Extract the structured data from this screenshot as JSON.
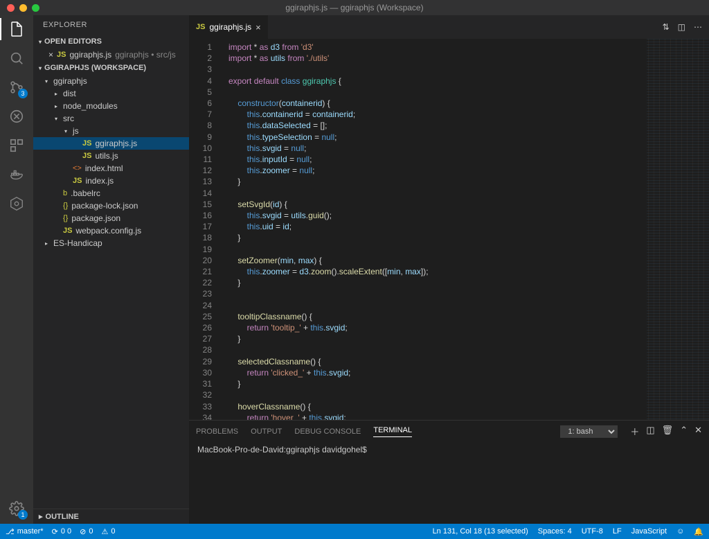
{
  "title": "ggiraphjs.js — ggiraphjs (Workspace)",
  "sidebar": {
    "header": "EXPLORER",
    "openEditors": {
      "label": "OPEN EDITORS",
      "items": [
        {
          "label": "ggiraphjs.js",
          "detail": "ggiraphjs • src/js"
        }
      ]
    },
    "workspace": {
      "label": "GGIRAPHJS (WORKSPACE)"
    },
    "tree": [
      {
        "indent": 0,
        "chev": "▾",
        "name": "ggiraphjs",
        "type": "folder"
      },
      {
        "indent": 1,
        "chev": "▸",
        "name": "dist",
        "type": "folder"
      },
      {
        "indent": 1,
        "chev": "▸",
        "name": "node_modules",
        "type": "folder"
      },
      {
        "indent": 1,
        "chev": "▾",
        "name": "src",
        "type": "folder"
      },
      {
        "indent": 2,
        "chev": "▾",
        "name": "js",
        "type": "folder"
      },
      {
        "indent": 3,
        "name": "ggiraphjs.js",
        "type": "js",
        "selected": true
      },
      {
        "indent": 3,
        "name": "utils.js",
        "type": "js"
      },
      {
        "indent": 2,
        "name": "index.html",
        "type": "html"
      },
      {
        "indent": 2,
        "name": "index.js",
        "type": "js"
      },
      {
        "indent": 1,
        "name": ".babelrc",
        "type": "babel"
      },
      {
        "indent": 1,
        "name": "package-lock.json",
        "type": "json"
      },
      {
        "indent": 1,
        "name": "package.json",
        "type": "json"
      },
      {
        "indent": 1,
        "name": "webpack.config.js",
        "type": "js"
      },
      {
        "indent": 0,
        "chev": "▸",
        "name": "ES-Handicap",
        "type": "folder"
      }
    ],
    "outline": "OUTLINE"
  },
  "scmBadge": "3",
  "settingsBadge": "1",
  "tab": {
    "name": "ggiraphjs.js"
  },
  "code": {
    "lines": 34,
    "rows": [
      {
        "n": 1,
        "h": "<span class='kw'>import</span> * <span class='kw'>as</span> <span class='id'>d3</span> <span class='kw'>from</span> <span class='str'>'d3'</span>"
      },
      {
        "n": 2,
        "h": "<span class='kw'>import</span> * <span class='kw'>as</span> <span class='id'>utils</span> <span class='kw'>from</span> <span class='str'>'./utils'</span>"
      },
      {
        "n": 3,
        "h": ""
      },
      {
        "n": 4,
        "h": "<span class='kw'>export</span> <span class='kw'>default</span> <span class='th'>class</span> <span class='cls'>ggiraphjs</span> {"
      },
      {
        "n": 5,
        "h": ""
      },
      {
        "n": 6,
        "h": "    <span class='th'>constructor</span>(<span class='id'>containerid</span>) {"
      },
      {
        "n": 7,
        "h": "        <span class='th'>this</span>.<span class='id'>containerid</span> = <span class='id'>containerid</span>;"
      },
      {
        "n": 8,
        "h": "        <span class='th'>this</span>.<span class='id'>dataSelected</span> = [];"
      },
      {
        "n": 9,
        "h": "        <span class='th'>this</span>.<span class='id'>typeSelection</span> = <span class='th'>null</span>;"
      },
      {
        "n": 10,
        "h": "        <span class='th'>this</span>.<span class='id'>svgid</span> = <span class='th'>null</span>;"
      },
      {
        "n": 11,
        "h": "        <span class='th'>this</span>.<span class='id'>inputId</span> = <span class='th'>null</span>;"
      },
      {
        "n": 12,
        "h": "        <span class='th'>this</span>.<span class='id'>zoomer</span> = <span class='th'>null</span>;"
      },
      {
        "n": 13,
        "h": "    }"
      },
      {
        "n": 14,
        "h": ""
      },
      {
        "n": 15,
        "h": "    <span class='fn'>setSvgId</span>(<span class='id'>id</span>) {"
      },
      {
        "n": 16,
        "h": "        <span class='th'>this</span>.<span class='id'>svgid</span> = <span class='id'>utils</span>.<span class='fn'>guid</span>();"
      },
      {
        "n": 17,
        "h": "        <span class='th'>this</span>.<span class='id'>uid</span> = <span class='id'>id</span>;"
      },
      {
        "n": 18,
        "h": "    }"
      },
      {
        "n": 19,
        "h": ""
      },
      {
        "n": 20,
        "h": "    <span class='fn'>setZoomer</span>(<span class='id'>min</span>, <span class='id'>max</span>) {"
      },
      {
        "n": 21,
        "h": "        <span class='th'>this</span>.<span class='id'>zoomer</span> = <span class='id'>d3</span>.<span class='fn'>zoom</span>().<span class='fn'>scaleExtent</span>([<span class='id'>min</span>, <span class='id'>max</span>]);"
      },
      {
        "n": 22,
        "h": "    }"
      },
      {
        "n": 23,
        "h": ""
      },
      {
        "n": 24,
        "h": ""
      },
      {
        "n": 25,
        "h": "    <span class='fn'>tooltipClassname</span>() {"
      },
      {
        "n": 26,
        "h": "        <span class='kw'>return</span> <span class='str'>'tooltip_'</span> + <span class='th'>this</span>.<span class='id'>svgid</span>;"
      },
      {
        "n": 27,
        "h": "    }"
      },
      {
        "n": 28,
        "h": ""
      },
      {
        "n": 29,
        "h": "    <span class='fn'>selectedClassname</span>() {"
      },
      {
        "n": 30,
        "h": "        <span class='kw'>return</span> <span class='str'>'clicked_'</span> + <span class='th'>this</span>.<span class='id'>svgid</span>;"
      },
      {
        "n": 31,
        "h": "    }"
      },
      {
        "n": 32,
        "h": ""
      },
      {
        "n": 33,
        "h": "    <span class='fn'>hoverClassname</span>() {"
      },
      {
        "n": 34,
        "h": "        <span class='kw'>return</span> <span class='str'>'hover_'</span> + <span class='th'>this</span>.<span class='id'>svgid</span>;"
      }
    ]
  },
  "panel": {
    "tabs": [
      "PROBLEMS",
      "OUTPUT",
      "DEBUG CONSOLE",
      "TERMINAL"
    ],
    "active": 3,
    "termSelect": "1: bash",
    "prompt": "MacBook-Pro-de-David:ggiraphjs davidgohel$"
  },
  "status": {
    "branch": "master*",
    "sync": "0 0",
    "errors": "0",
    "warnings": "0",
    "lncol": "Ln 131, Col 18 (13 selected)",
    "spaces": "Spaces: 4",
    "encoding": "UTF-8",
    "eol": "LF",
    "lang": "JavaScript"
  }
}
